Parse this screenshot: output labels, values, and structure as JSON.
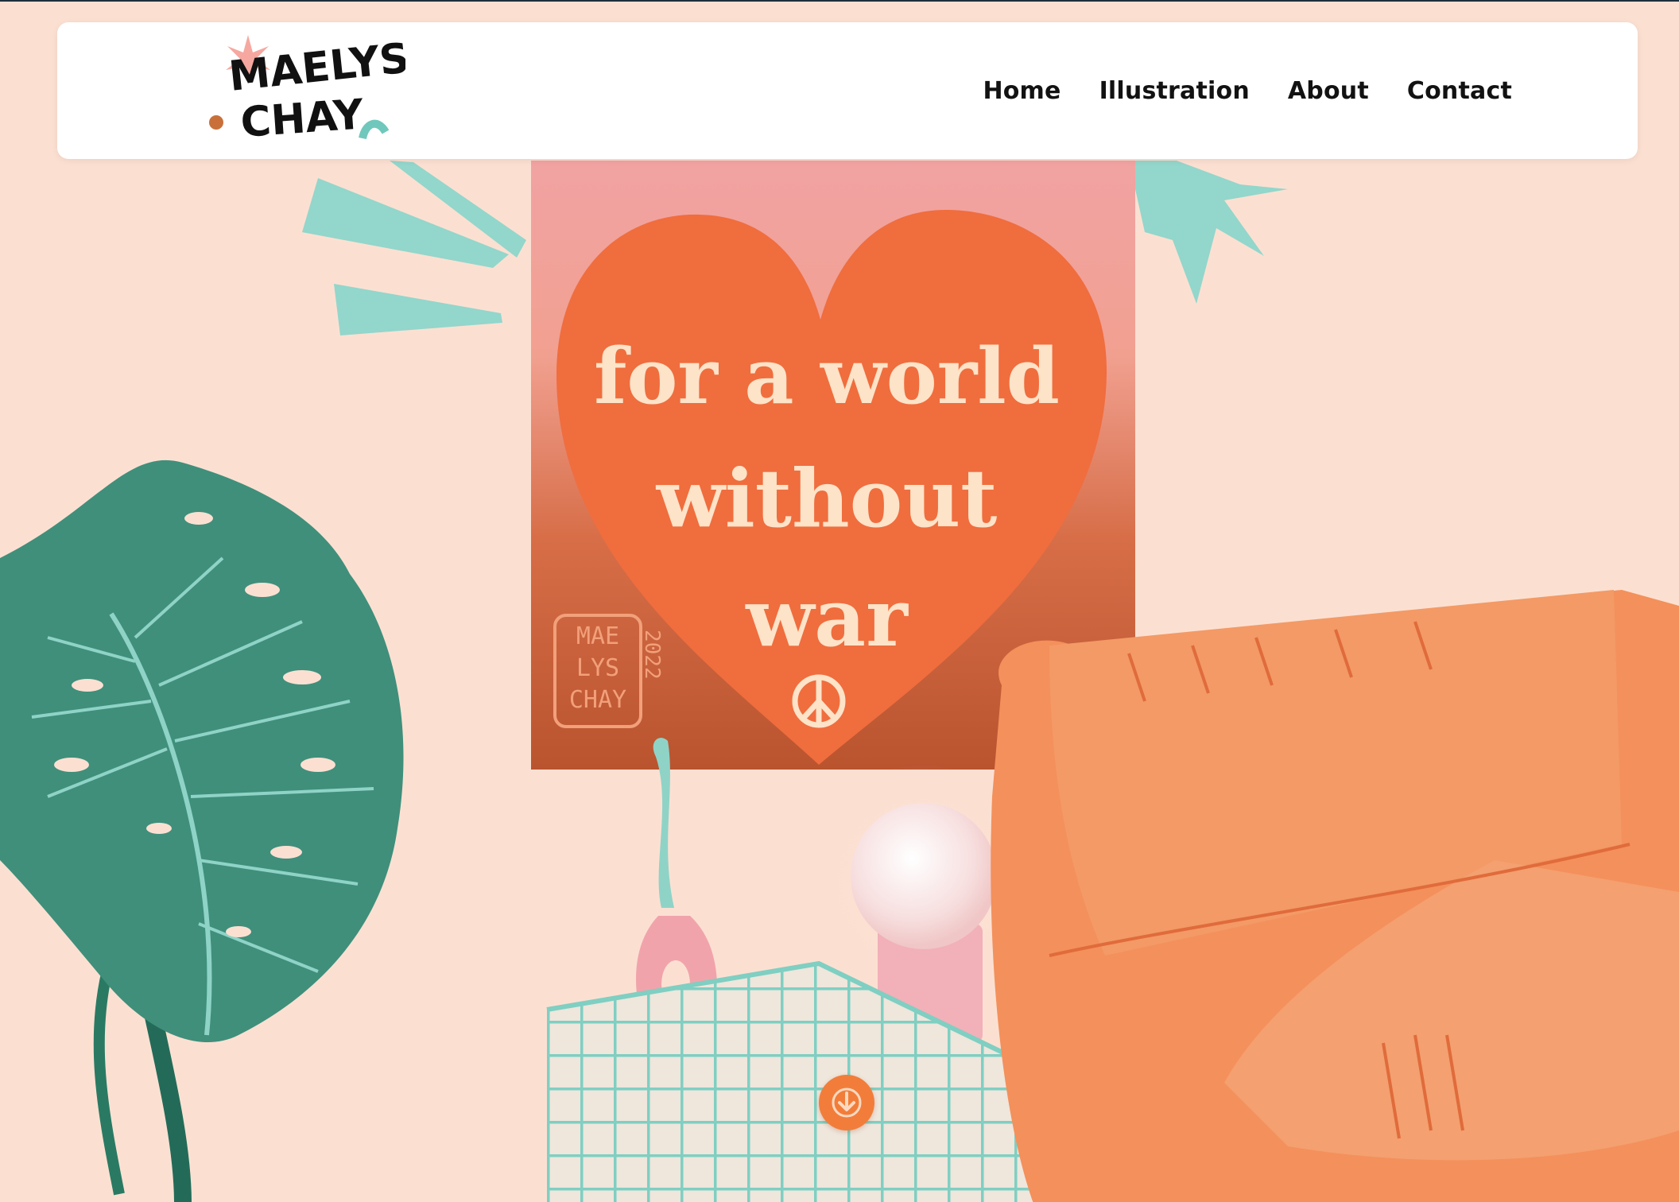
{
  "nav": {
    "logo_text_line1": "MAELYS",
    "logo_text_line2": "CHAY",
    "links": [
      {
        "label": "Home"
      },
      {
        "label": "Illustration"
      },
      {
        "label": "About"
      },
      {
        "label": "Contact"
      }
    ]
  },
  "hero": {
    "poster_line1": "for a world",
    "poster_line2": "without",
    "poster_line3": "war",
    "signature_line1": "MAE",
    "signature_line2": "LYS",
    "signature_line3": "CHAY",
    "signature_year": "2022",
    "scroll_icon": "arrow-down-icon"
  },
  "colors": {
    "background": "#fbe0d2",
    "accent_orange": "#f27d3a",
    "teal": "#8fd3c7",
    "leaf_green": "#3e8f7c",
    "sofa": "#f3905e",
    "poster_pink": "#f2a7a2",
    "heart": "#f0703f",
    "cream_text": "#fde6c8"
  }
}
